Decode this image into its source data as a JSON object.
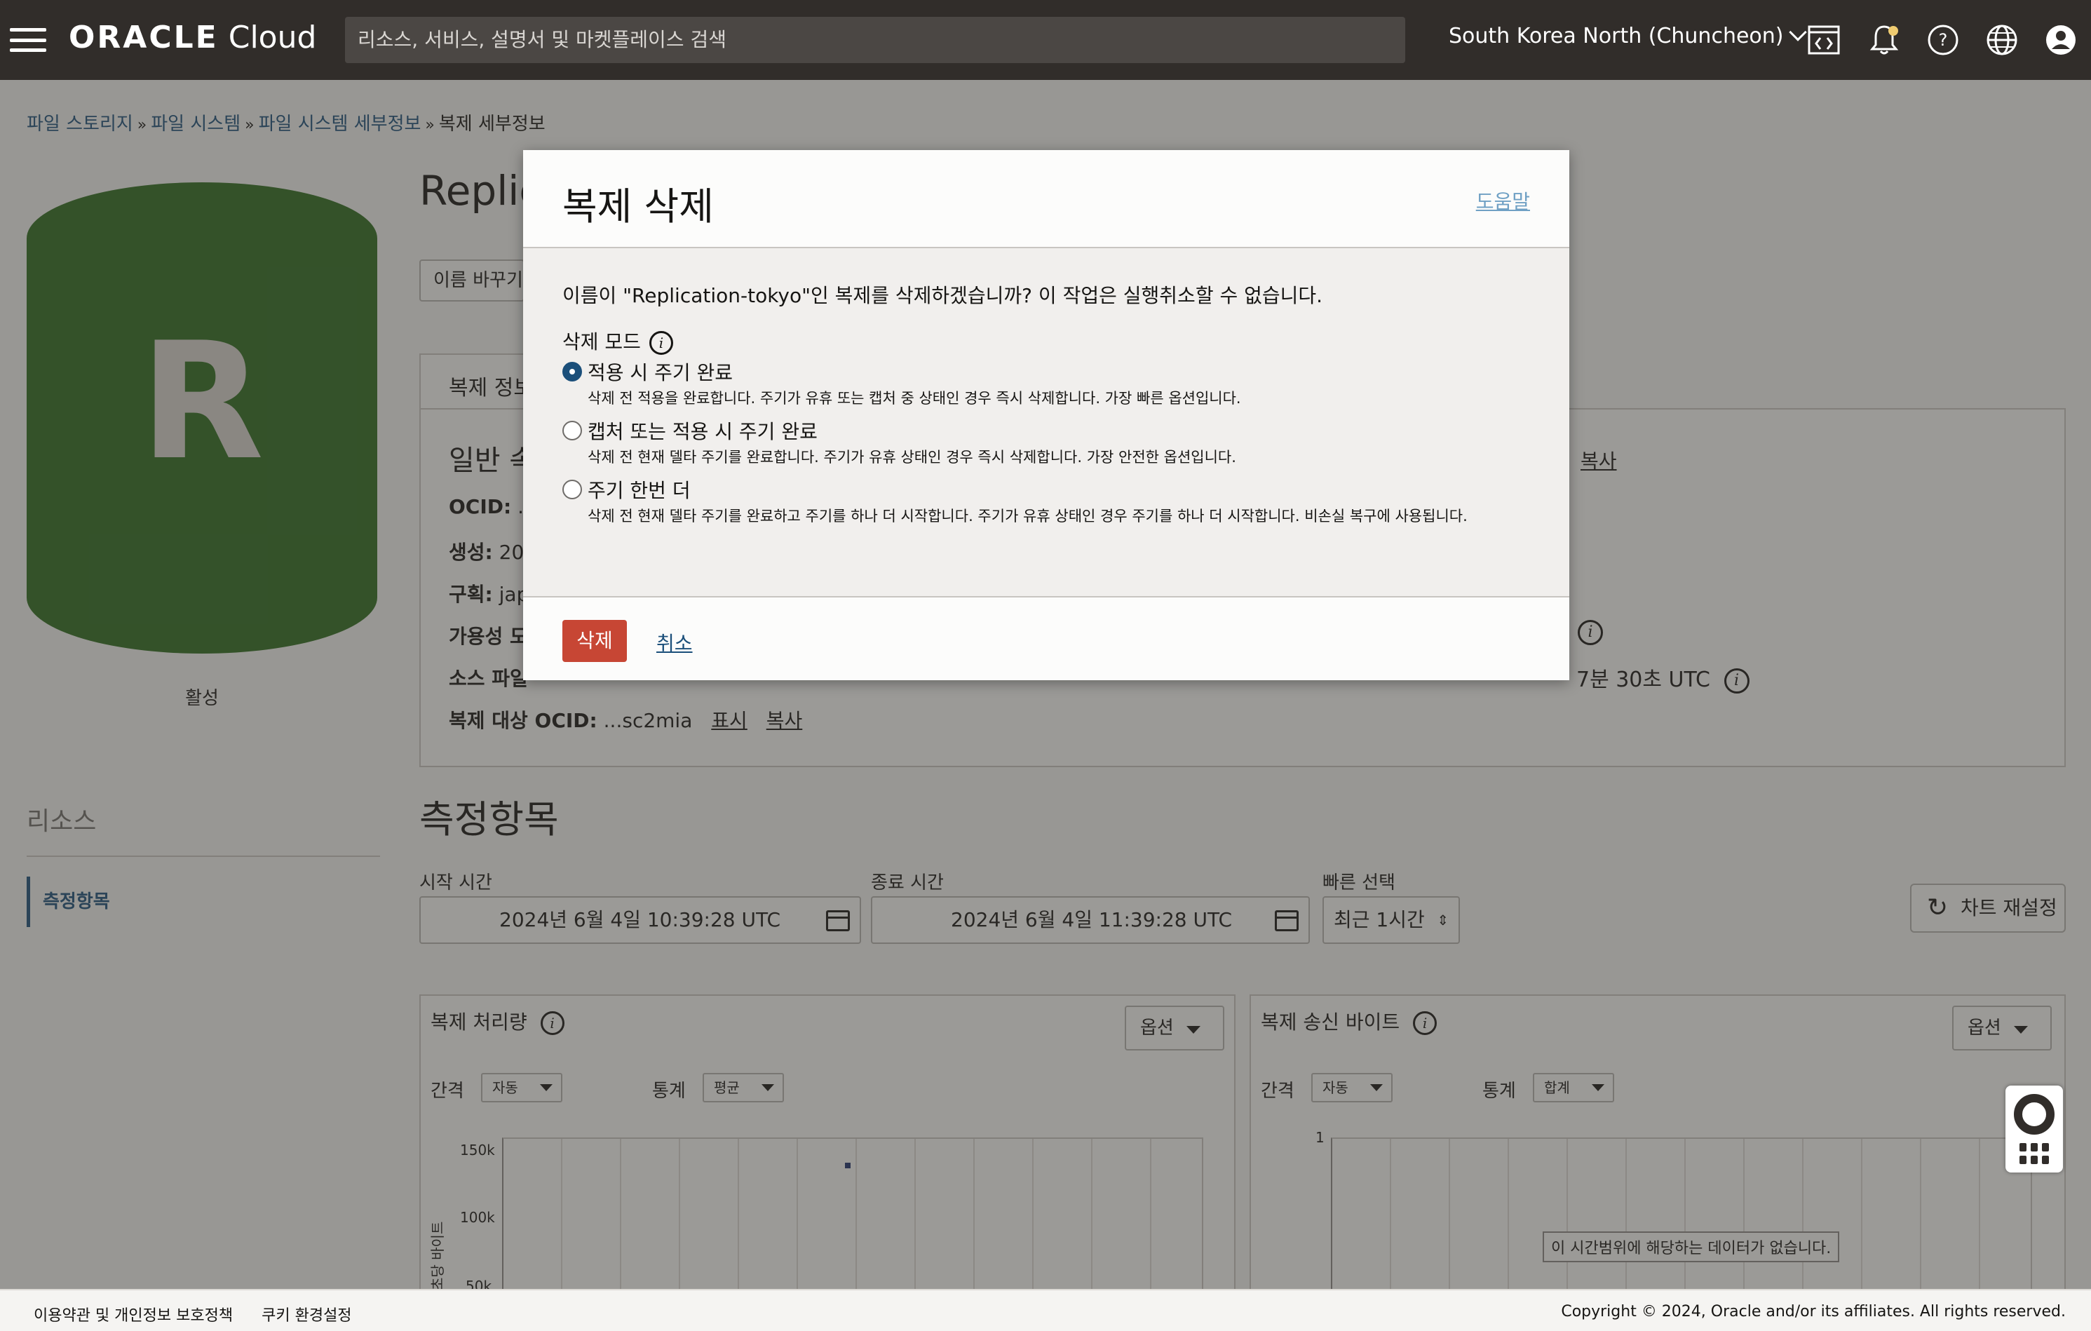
{
  "header": {
    "logo_brand": "ORACLE",
    "logo_product": "Cloud",
    "search_placeholder": "리소스, 서비스, 설명서 및 마켓플레이스 검색",
    "region": "South Korea North (Chuncheon)",
    "icons": [
      "menu-icon",
      "code-editor-icon",
      "bell-icon",
      "help-icon",
      "globe-icon",
      "user-icon"
    ],
    "notification_dot_color": "#f0cc71"
  },
  "breadcrumb": {
    "items": [
      "파일 스토리지",
      "파일 시스템",
      "파일 시스템 세부정보"
    ],
    "separator": "»",
    "current": "복제 세부정보"
  },
  "sidebar": {
    "avatar_letter": "R",
    "avatar_color": "#2c6b1d",
    "status": "활성",
    "resources_title": "리소스",
    "items": [
      {
        "label": "측정항목"
      }
    ]
  },
  "detail": {
    "title": "Replic",
    "rename_button": "이름 바꾸기",
    "info_tab": "복제 정보",
    "section_heading": "일반 속",
    "rows": {
      "ocid_label": "OCID:",
      "ocid_value": "..",
      "created_label": "생성:",
      "created_value": "202",
      "compartment_label": "구획:",
      "compartment_value": "jap",
      "ad_label": "가용성 도",
      "source_label": "소스 파일",
      "target_ocid_label": "복제 대상 OCID:",
      "target_ocid_value": "...sc2mia",
      "show_link": "표시",
      "copy_link": "복사"
    },
    "copy_right_link": "복사",
    "lag_text": "7분 30초 UTC"
  },
  "metrics": {
    "title": "측정항목",
    "start_label": "시작 시간",
    "start_value": "2024년 6월 4일 10:39:28 UTC",
    "end_label": "종료 시간",
    "end_value": "2024년 6월 4일 11:39:28 UTC",
    "quick_label": "빠른 선택",
    "quick_value": "최근 1시간",
    "reset_button": "차트 재설정",
    "charts": [
      {
        "title": "복제 처리량",
        "options": "옵션",
        "interval_label": "간격",
        "interval_value": "자동",
        "stat_label": "통계",
        "stat_value": "평균",
        "ylabel": "초당 바이트",
        "yticks": [
          "150k",
          "100k",
          "50k"
        ]
      },
      {
        "title": "복제 송신 바이트",
        "options": "옵션",
        "interval_label": "간격",
        "interval_value": "자동",
        "stat_label": "통계",
        "stat_value": "합계",
        "yticks": [
          "1"
        ],
        "no_data": "이 시간범위에 해당하는 데이터가 없습니다."
      }
    ]
  },
  "dialog": {
    "title": "복제 삭제",
    "help_link": "도움말",
    "message": "이름이 \"Replication-tokyo\"인 복제를 삭제하겠습니까? 이 작업은 실행취소할 수 없습니다.",
    "mode_label": "삭제 모드",
    "options": [
      {
        "title": "적용 시 주기 완료",
        "desc": "삭제 전 적용을 완료합니다. 주기가 유휴 또는 캡처 중 상태인 경우 즉시 삭제합니다. 가장 빠른 옵션입니다.",
        "selected": true
      },
      {
        "title": "캡처 또는 적용 시 주기 완료",
        "desc": "삭제 전 현재 델타 주기를 완료합니다. 주기가 유휴 상태인 경우 즉시 삭제합니다. 가장 안전한 옵션입니다.",
        "selected": false
      },
      {
        "title": "주기 한번 더",
        "desc": "삭제 전 현재 델타 주기를 완료하고 주기를 하나 더 시작합니다. 주기가 유휴 상태인 경우 주기를 하나 더 시작합니다. 비손실 복구에 사용됩니다.",
        "selected": false
      }
    ],
    "delete_button": "삭제",
    "cancel_link": "취소",
    "delete_color": "#c74634"
  },
  "footer": {
    "terms": "이용약관 및 개인정보 보호정책",
    "cookies": "쿠키 환경설정",
    "copyright": "Copyright © 2024, Oracle and/or its affiliates. All rights reserved."
  }
}
